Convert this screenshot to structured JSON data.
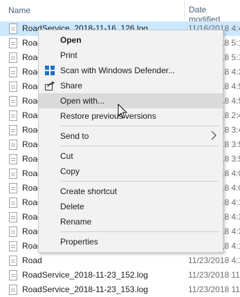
{
  "columns": {
    "name": "Name",
    "date_modified": "Date modified"
  },
  "files": [
    {
      "name": "RoadService_2018-11-16_126.log",
      "date": "11/16/2018 4:4",
      "selected": true
    },
    {
      "name": "Road",
      "date": "11/16/2018 5:1",
      "selected": false
    },
    {
      "name": "Road",
      "date": "11/16/2018 5:1",
      "selected": false
    },
    {
      "name": "Road",
      "date": "11/16/2018 4:3",
      "selected": false
    },
    {
      "name": "Road",
      "date": "11/16/2018 4:5",
      "selected": false
    },
    {
      "name": "Road",
      "date": "11/16/2018 4:5",
      "selected": false
    },
    {
      "name": "Road",
      "date": "11/16/2018 2:4",
      "selected": false
    },
    {
      "name": "Road",
      "date": "11/16/2018 3:4",
      "selected": false
    },
    {
      "name": "Road",
      "date": "11/16/2018 3:5",
      "selected": false
    },
    {
      "name": "Road",
      "date": "11/16/2018 3:5",
      "selected": false
    },
    {
      "name": "Road",
      "date": "11/16/2018 4:0",
      "selected": false
    },
    {
      "name": "Road",
      "date": "11/16/2018 4:0",
      "selected": false
    },
    {
      "name": "Road",
      "date": "11/16/2018 4:1",
      "selected": false
    },
    {
      "name": "Road",
      "date": "11/16/2018 4:3",
      "selected": false
    },
    {
      "name": "Road",
      "date": "11/16/2018 4:3",
      "selected": false
    },
    {
      "name": "Road",
      "date": "11/23/2018 4:1",
      "selected": false
    },
    {
      "name": "Road",
      "date": "11/23/2018 4:1",
      "selected": false
    },
    {
      "name": "RoadService_2018-11-23_152.log",
      "date": "11/23/2018 11:",
      "selected": false
    },
    {
      "name": "RoadService_2018-11-23_153.log",
      "date": "11/23/2018 11:",
      "selected": false
    }
  ],
  "context_menu": {
    "open": "Open",
    "print": "Print",
    "scan": "Scan with Windows Defender...",
    "share": "Share",
    "open_with": "Open with...",
    "restore": "Restore previous versions",
    "send_to": "Send to",
    "cut": "Cut",
    "copy": "Copy",
    "create_shortcut": "Create shortcut",
    "delete": "Delete",
    "rename": "Rename",
    "properties": "Properties"
  },
  "colors": {
    "selection": "#cce8ff",
    "menu_bg": "#f2f2f2",
    "menu_hover": "#dadada",
    "defender_blue": "#1f6fc5"
  },
  "icons": {
    "scan": "windows-defender-icon",
    "share": "share-icon",
    "send_to_arrow": "chevron-right-icon"
  }
}
